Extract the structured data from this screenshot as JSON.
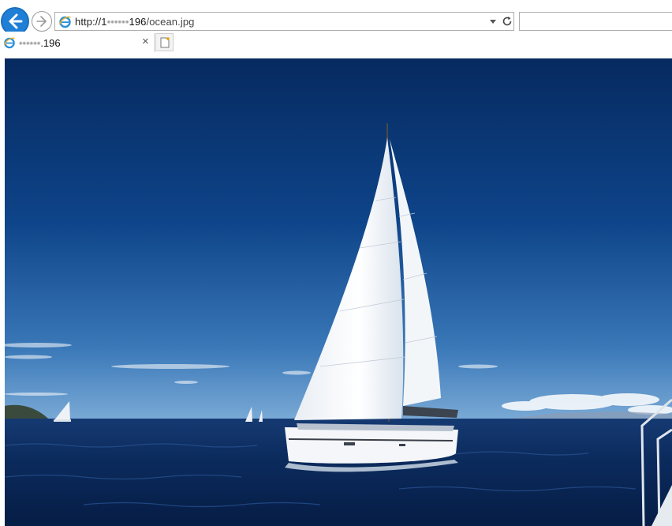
{
  "browser": {
    "address": {
      "scheme": "http://1",
      "host_blurred": "••••••",
      "host_tail": "196",
      "path": "/ocean.jpg"
    },
    "tab": {
      "title_blurred": "••••••",
      "title_tail": ".196",
      "close_label": "×"
    }
  },
  "content": {
    "image_alt": "ocean.jpg"
  },
  "colors": {
    "back_button": "#1f7fd6",
    "sky_top": "#062a60",
    "sky_bottom": "#5d93c9",
    "sea": "#0a2a5c"
  },
  "icons": [
    "back-arrow-icon",
    "forward-arrow-icon",
    "ie-logo-icon",
    "dropdown-arrow-icon",
    "refresh-icon",
    "close-icon",
    "new-tab-icon"
  ]
}
